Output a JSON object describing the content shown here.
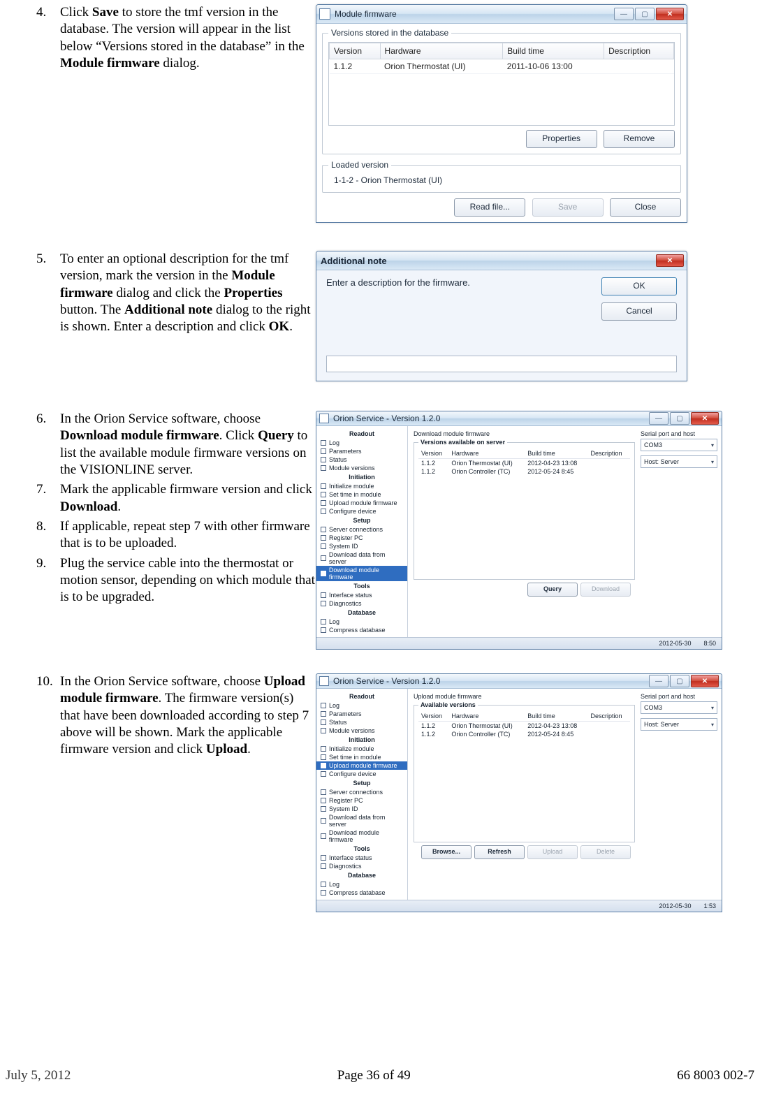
{
  "steps": {
    "s4": {
      "num": "4.",
      "body_pre": "Click ",
      "b1": "Save",
      "body_mid": " to store the tmf version in the database. The version will appear in the list below “Versions stored in the database” in the ",
      "b2": "Module firmware",
      "body_post": " dialog."
    },
    "s5": {
      "num": "5.",
      "t1": "To enter an optional description for the tmf version, mark the version in the ",
      "b1": "Module firmware",
      "t2": " dialog and click the ",
      "b2": "Properties",
      "t3": " button. The ",
      "b3": "Additional note",
      "t4": " dialog to the right is shown. Enter a description and click ",
      "b4": "OK",
      "t5": "."
    },
    "s6": {
      "num": "6.",
      "t1": "In the Orion Service software, choose ",
      "b1": "Download module firmware",
      "t2": ". Click ",
      "b2": "Query",
      "t3": " to list the available module firmware versions on the VISIONLINE server."
    },
    "s7": {
      "num": "7.",
      "t1": "Mark the applicable firmware version and click ",
      "b1": "Download",
      "t2": "."
    },
    "s8": {
      "num": "8.",
      "t1": "If applicable, repeat step 7 with other firmware that is to be uploaded."
    },
    "s9": {
      "num": "9.",
      "t1": "Plug the service cable into the thermostat or motion sensor, depending on which module that is to be upgraded."
    },
    "s10": {
      "num": "10.",
      "t1": "In the Orion Service software, choose ",
      "b1": "Upload module firmware",
      "t2": ". The firmware version(s) that have been downloaded according to step 7 above will be shown. Mark the applicable firmware version and click ",
      "b2": "Upload",
      "t3": "."
    }
  },
  "dlg1": {
    "title": "Module firmware",
    "group1": "Versions stored in the database",
    "cols": {
      "c1": "Version",
      "c2": "Hardware",
      "c3": "Build time",
      "c4": "Description"
    },
    "row": {
      "v": "1.1.2",
      "hw": "Orion Thermostat (UI)",
      "bt": "2011-10-06   13:00",
      "d": ""
    },
    "props": "Properties",
    "remove": "Remove",
    "group2": "Loaded version",
    "loaded": "1-1-2 - Orion Thermostat (UI)",
    "read": "Read file...",
    "save": "Save",
    "close": "Close"
  },
  "dlg2": {
    "title": "Additional note",
    "msg": "Enter a description for the firmware.",
    "ok": "OK",
    "cancel": "Cancel"
  },
  "app_common": {
    "title": "Orion Service - Version 1.2.0",
    "serial_lbl": "Serial port and host",
    "serial_val": "COM3",
    "host_lbl": "Host: Server",
    "sidebar": {
      "readout": "Readout",
      "items_readout": [
        "Log",
        "Parameters",
        "Status",
        "Module versions"
      ],
      "init": "Initiation",
      "items_init": [
        "Initialize module",
        "Set time in module",
        "Upload module firmware",
        "Configure device"
      ],
      "setup": "Setup",
      "items_setup": [
        "Server connections",
        "Register PC",
        "System ID",
        "Download data from server",
        "Download module firmware"
      ],
      "tools": "Tools",
      "items_tools": [
        "Interface status",
        "Diagnostics"
      ],
      "db": "Database",
      "items_db": [
        "Log",
        "Compress database"
      ]
    }
  },
  "app1": {
    "main_title": "Download module firmware",
    "legend": "Versions available on server",
    "cols": {
      "c1": "Version",
      "c2": "Hardware",
      "c3": "Build time",
      "c4": "Description"
    },
    "rows": [
      {
        "v": "1.1.2",
        "hw": "Orion Thermostat (UI)",
        "bt": "2012-04-23   13:08"
      },
      {
        "v": "1.1.2",
        "hw": "Orion Controller (TC)",
        "bt": "2012-05-24    8:45"
      }
    ],
    "query": "Query",
    "download": "Download",
    "status_date": "2012-05-30",
    "status_time": "8:50",
    "selected": "Download module firmware"
  },
  "app2": {
    "main_title": "Upload module firmware",
    "legend": "Available versions",
    "cols": {
      "c1": "Version",
      "c2": "Hardware",
      "c3": "Build time",
      "c4": "Description"
    },
    "rows": [
      {
        "v": "1.1.2",
        "hw": "Orion Thermostat (UI)",
        "bt": "2012-04-23   13:08"
      },
      {
        "v": "1.1.2",
        "hw": "Orion Controller (TC)",
        "bt": "2012-05-24    8:45"
      }
    ],
    "browse": "Browse...",
    "refresh": "Refresh",
    "upload": "Upload",
    "delete": "Delete",
    "status_date": "2012-05-30",
    "status_time": "1:53",
    "selected": "Upload module firmware"
  },
  "footer": {
    "date": "July 5, 2012",
    "page": "Page 36 of 49",
    "doc": "66 8003 002-7"
  }
}
